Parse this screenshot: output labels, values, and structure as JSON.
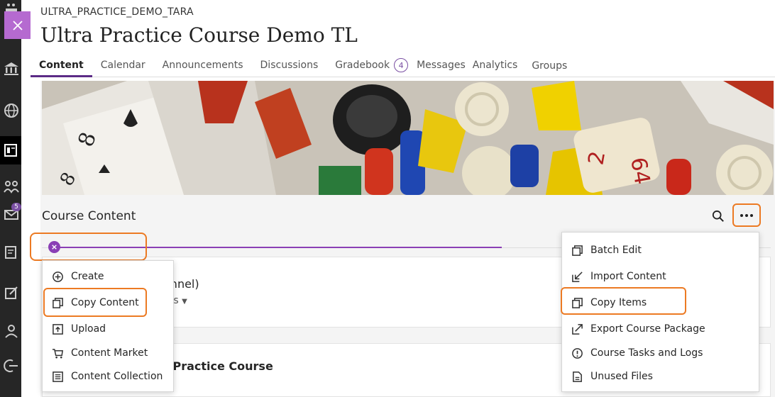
{
  "course": {
    "code": "ULTRA_PRACTICE_DEMO_TARA",
    "title": "Ultra Practice Course Demo TL"
  },
  "tabs": [
    {
      "label": "Content"
    },
    {
      "label": "Calendar"
    },
    {
      "label": "Announcements"
    },
    {
      "label": "Discussions"
    },
    {
      "label": "Gradebook",
      "count": "4"
    },
    {
      "label": "Messages"
    },
    {
      "label": "Analytics"
    },
    {
      "label": "Groups"
    }
  ],
  "left_nav": {
    "messages_badge": "5",
    "icons": [
      "logo-icon",
      "institution-icon",
      "globe-icon",
      "courses-icon",
      "groups-icon",
      "messages-icon",
      "grades-icon",
      "tools-icon",
      "profile-icon",
      "sign-out-icon"
    ]
  },
  "content": {
    "heading": "Course Content",
    "card1_title_fragment": "annel)",
    "card1_sub_fragment": "nts",
    "card2_title_fragment": "r Practice Course"
  },
  "create_menu": {
    "items": [
      {
        "label": "Create",
        "icon": "plus-circle-icon"
      },
      {
        "label": "Copy Content",
        "icon": "copy-icon"
      },
      {
        "label": "Upload",
        "icon": "upload-icon"
      },
      {
        "label": "Content Market",
        "icon": "cart-icon"
      },
      {
        "label": "Content Collection",
        "icon": "collection-icon"
      }
    ]
  },
  "more_menu": {
    "items": [
      {
        "label": "Batch Edit",
        "icon": "batch-edit-icon"
      },
      {
        "label": "Import Content",
        "icon": "import-icon"
      },
      {
        "label": "Copy Items",
        "icon": "copy-icon"
      },
      {
        "label": "Export Course Package",
        "icon": "export-icon"
      },
      {
        "label": "Course Tasks and Logs",
        "icon": "alert-icon"
      },
      {
        "label": "Unused Files",
        "icon": "file-icon"
      }
    ]
  },
  "colors": {
    "accent": "#8a3fb5",
    "highlight": "#ec7a23",
    "close_bg": "#b56ad0"
  }
}
